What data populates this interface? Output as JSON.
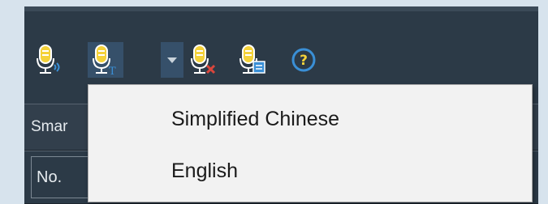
{
  "toolbar": {
    "icons": [
      "mic-voice-icon",
      "mic-text-icon",
      "dropdown-arrow-icon",
      "mic-delete-icon",
      "mic-settings-icon",
      "help-icon"
    ],
    "help_glyph": "?",
    "text_badge": "T"
  },
  "panel": {
    "smart_label": "Smar",
    "no_label": "No."
  },
  "language_menu": {
    "items": [
      {
        "label": "Simplified Chinese"
      },
      {
        "label": "English"
      }
    ]
  },
  "colors": {
    "frame": "#2c3a47",
    "menu_bg": "#f2f2f2",
    "icon_yellow": "#f4d23a",
    "accent_blue": "#3a8fd6",
    "delete_red": "#d9463c"
  }
}
